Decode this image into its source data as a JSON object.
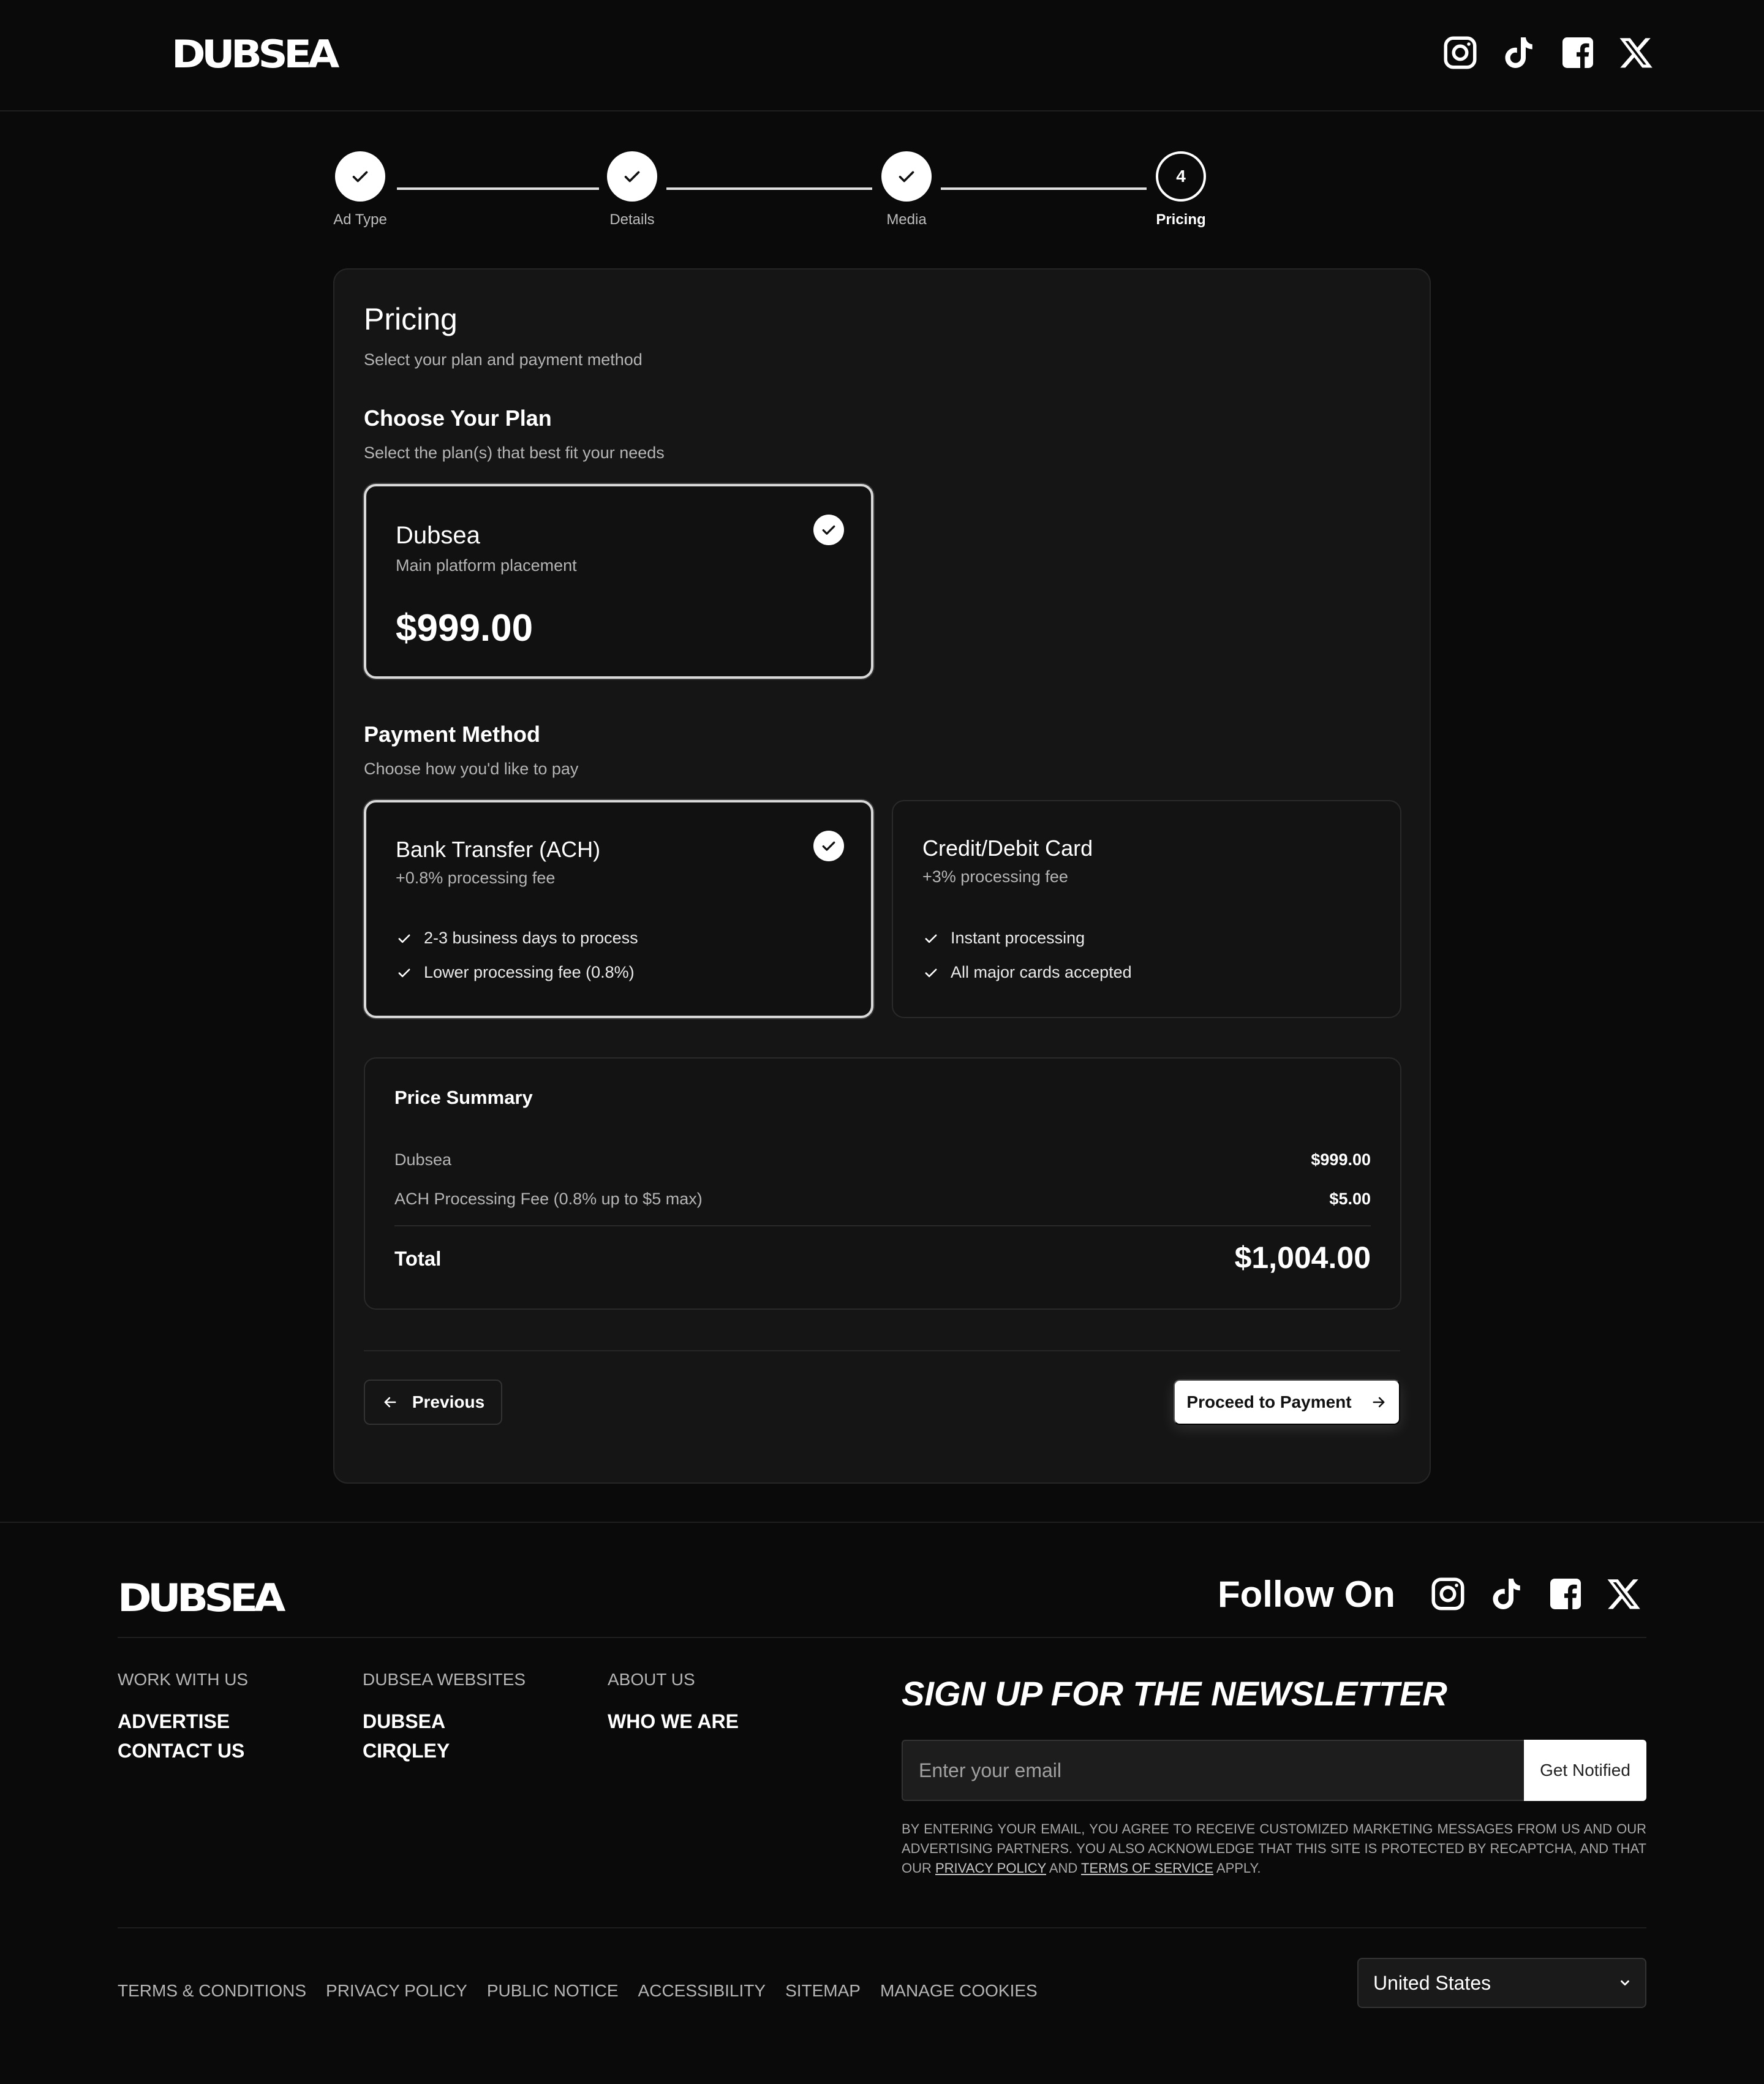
{
  "brand": {
    "logo_text": "DUBSEA"
  },
  "header": {
    "socials": [
      "instagram-icon",
      "tiktok-icon",
      "facebook-icon",
      "x-icon"
    ]
  },
  "stepper": {
    "steps": [
      {
        "label": "Ad Type",
        "state": "done"
      },
      {
        "label": "Details",
        "state": "done"
      },
      {
        "label": "Media",
        "state": "done"
      },
      {
        "label": "Pricing",
        "state": "current",
        "number": "4"
      }
    ]
  },
  "pricing": {
    "title": "Pricing",
    "subtitle": "Select your plan and payment method",
    "plan_section": {
      "title": "Choose Your Plan",
      "subtitle": "Select the plan(s) that best fit your needs",
      "plan": {
        "name": "Dubsea",
        "description": "Main platform placement",
        "price": "$999.00",
        "selected": true
      }
    },
    "payment_section": {
      "title": "Payment Method",
      "subtitle": "Choose how you'd like to pay",
      "methods": [
        {
          "name": "Bank Transfer (ACH)",
          "fee": "+0.8% processing fee",
          "selected": true,
          "features": [
            "2-3 business days to process",
            "Lower processing fee (0.8%)"
          ]
        },
        {
          "name": "Credit/Debit Card",
          "fee": "+3% processing fee",
          "selected": false,
          "features": [
            "Instant processing",
            "All major cards accepted"
          ]
        }
      ]
    },
    "summary": {
      "title": "Price Summary",
      "rows": [
        {
          "label": "Dubsea",
          "value": "$999.00"
        },
        {
          "label": "ACH Processing Fee (0.8% up to $5 max)",
          "value": "$5.00"
        }
      ],
      "total_label": "Total",
      "total_value": "$1,004.00"
    },
    "actions": {
      "previous": "Previous",
      "next": "Proceed to Payment"
    }
  },
  "footer": {
    "follow_text": "Follow On",
    "columns": [
      {
        "heading": "WORK WITH US",
        "links": [
          "ADVERTISE",
          "CONTACT US"
        ]
      },
      {
        "heading": "DUBSEA WEBSITES",
        "links": [
          "DUBSEA",
          "CIRQLEY"
        ]
      },
      {
        "heading": "ABOUT US",
        "links": [
          "WHO WE ARE"
        ]
      }
    ],
    "newsletter": {
      "title": "SIGN UP FOR THE NEWSLETTER",
      "placeholder": "Enter your email",
      "button": "Get Notified",
      "legal_before": "By entering your email, you agree to receive customized marketing messages from us and our advertising partners. You also acknowledge that this site is protected by reCAPTCHA, and that our ",
      "privacy_link": "Privacy Policy",
      "and": " and ",
      "terms_link": "Terms of Service",
      "legal_after": " apply."
    },
    "bottom_links": [
      "TERMS & CONDITIONS",
      "PRIVACY POLICY",
      "PUBLIC NOTICE",
      "ACCESSIBILITY",
      "SITEMAP",
      "MANAGE COOKIES"
    ],
    "country_select": {
      "selected": "United States"
    }
  },
  "colors": {
    "background": "#0a0a0a",
    "card": "#151515",
    "accent": "#ffffff",
    "muted": "#b5b5b5"
  }
}
